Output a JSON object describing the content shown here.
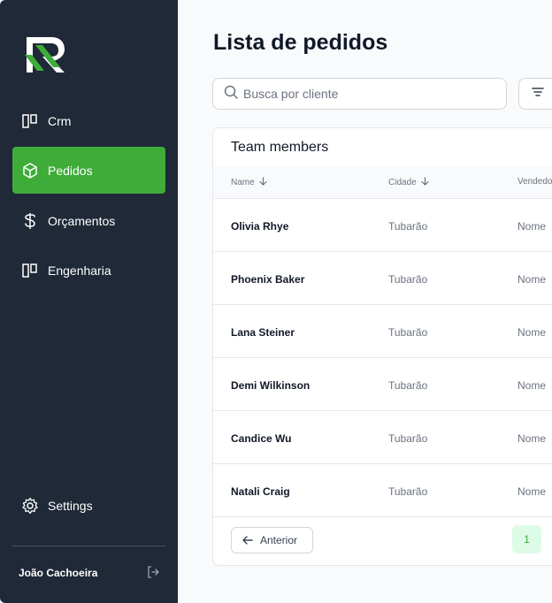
{
  "sidebar": {
    "items": [
      {
        "label": "Crm",
        "icon": "columns-icon"
      },
      {
        "label": "Pedidos",
        "icon": "box-icon"
      },
      {
        "label": "Orçamentos",
        "icon": "dollar-icon"
      },
      {
        "label": "Engenharia",
        "icon": "columns-icon"
      }
    ],
    "settings_label": "Settings",
    "user_name": "João Cachoeira"
  },
  "main": {
    "title": "Lista de pedidos",
    "search": {
      "placeholder": "Busca por cliente",
      "value": ""
    },
    "card": {
      "title": "Team members",
      "columns": [
        "Name",
        "Cidade",
        "Vendedo"
      ],
      "rows": [
        {
          "name": "Olivia Rhye",
          "cidade": "Tubarão",
          "vendedor": "Nome"
        },
        {
          "name": "Phoenix Baker",
          "cidade": "Tubarão",
          "vendedor": "Nome"
        },
        {
          "name": "Lana Steiner",
          "cidade": "Tubarão",
          "vendedor": "Nome"
        },
        {
          "name": "Demi Wilkinson",
          "cidade": "Tubarão",
          "vendedor": "Nome"
        },
        {
          "name": "Candice Wu",
          "cidade": "Tubarão",
          "vendedor": "Nome"
        },
        {
          "name": "Natali Craig",
          "cidade": "Tubarão",
          "vendedor": "Nome"
        }
      ],
      "prev_label": "Anterior",
      "current_page": "1"
    }
  },
  "colors": {
    "accent": "#3fac3a",
    "sidebar_bg": "#1f2937",
    "page_active_bg": "#dcfce7"
  }
}
